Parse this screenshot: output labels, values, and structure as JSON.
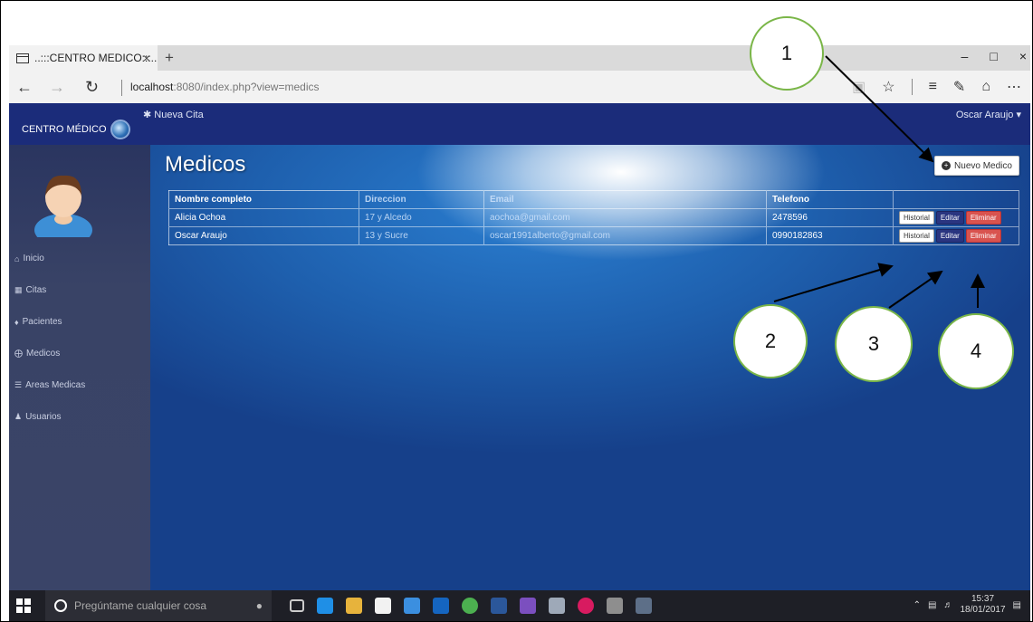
{
  "browser": {
    "tab_title": "..:::CENTRO MEDICO:::..",
    "tab_close": "×",
    "new_tab": "+",
    "url_host": "localhost",
    "url_rest": ":8080/index.php?view=medics",
    "window_buttons": [
      "–",
      "□",
      "×"
    ]
  },
  "app": {
    "brand": "CENTRO MÉDICO",
    "nueva_cita": "Nueva Cita",
    "user": "Oscar Araujo",
    "sidebar": [
      {
        "label": "Inicio",
        "icon": "home-icon"
      },
      {
        "label": "Citas",
        "icon": "calendar-icon"
      },
      {
        "label": "Pacientes",
        "icon": "patient-icon"
      },
      {
        "label": "Medicos",
        "icon": "medic-icon"
      },
      {
        "label": "Areas Medicas",
        "icon": "list-icon"
      },
      {
        "label": "Usuarios",
        "icon": "users-icon"
      }
    ],
    "page_title": "Medicos",
    "new_button": "Nuevo Medico",
    "table": {
      "headers": [
        "Nombre completo",
        "Direccion",
        "Email",
        "Telefono",
        ""
      ],
      "rows": [
        {
          "name": "Alicia Ochoa",
          "address": "17 y Alcedo",
          "email": "aochoa@gmail.com",
          "phone": "2478596"
        },
        {
          "name": "Oscar Araujo",
          "address": "13 y Sucre",
          "email": "oscar1991alberto@gmail.com",
          "phone": "0990182863"
        }
      ],
      "actions": {
        "history": "Historial",
        "edit": "Editar",
        "delete": "Eliminar"
      }
    }
  },
  "callouts": [
    "1",
    "2",
    "3",
    "4"
  ],
  "taskbar": {
    "search_placeholder": "Pregúntame cualquier cosa",
    "time": "15:37",
    "date": "18/01/2017"
  }
}
